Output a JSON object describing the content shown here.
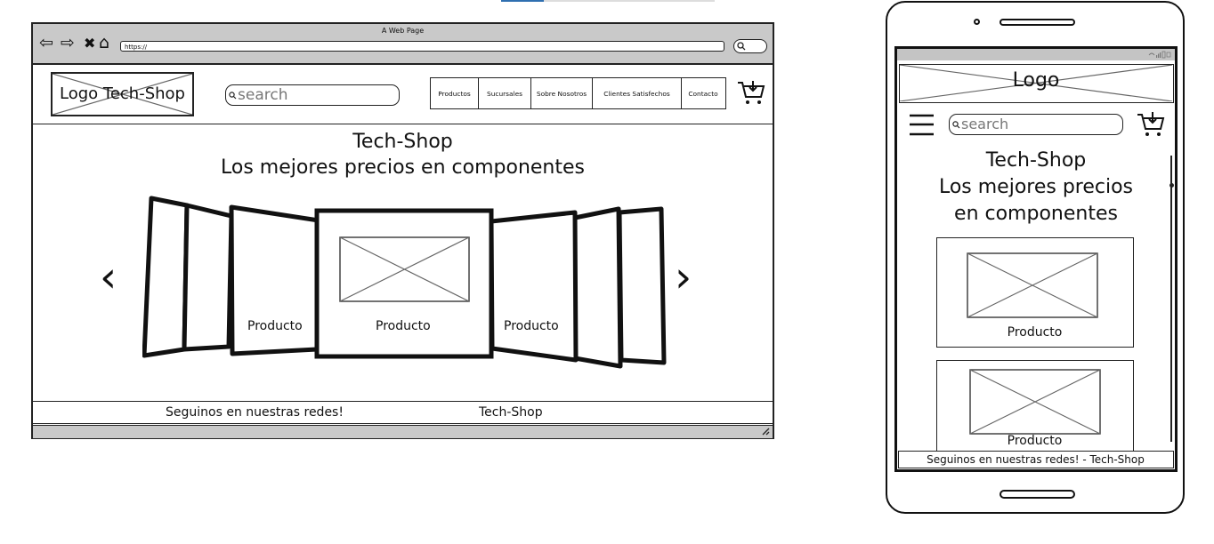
{
  "desktop": {
    "browser_title": "A Web Page",
    "nav_glyphs": {
      "back": "⇦",
      "forward": "⇨",
      "stop": "✖",
      "home": "⌂"
    },
    "url": "https://",
    "logo": "Logo Tech-Shop",
    "search_placeholder": "search",
    "nav": [
      {
        "label": "Productos"
      },
      {
        "label": "Sucursales"
      },
      {
        "label": "Sobre Nosotros"
      },
      {
        "label": "Clientes Satisfechos"
      },
      {
        "label": "Contacto"
      }
    ],
    "hero_title": "Tech-Shop",
    "hero_subtitle": "Los mejores precios en componentes",
    "carousel": {
      "prev_glyph": "‹",
      "next_glyph": "›",
      "items": [
        {
          "label": "Producto"
        },
        {
          "label": "Producto"
        },
        {
          "label": "Producto"
        }
      ]
    },
    "footer_left": "Seguinos en nuestras redes!",
    "footer_right": "Tech-Shop"
  },
  "mobile": {
    "logo": "Logo",
    "search_placeholder": "search",
    "hero_line1": "Tech-Shop",
    "hero_line2": "Los mejores precios",
    "hero_line3": "en componentes",
    "products": [
      {
        "label": "Producto"
      },
      {
        "label": "Producto"
      }
    ],
    "footer": "Seguinos en nuestras redes! - Tech-Shop"
  }
}
